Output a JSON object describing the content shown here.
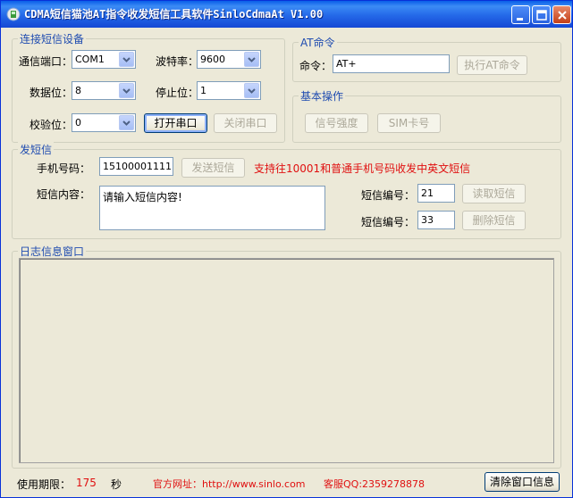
{
  "window": {
    "title": "CDMA短信猫池AT指令收发短信工具软件SinloCdmaAt V1.00"
  },
  "connect_group": {
    "legend": "连接短信设备",
    "port_label": "通信端口：",
    "port_value": "COM1",
    "baud_label": "波特率：",
    "baud_value": "9600",
    "databits_label": "数据位：",
    "databits_value": "8",
    "stopbits_label": "停止位：",
    "stopbits_value": "1",
    "parity_label": "校验位：",
    "parity_value": "0",
    "open_label": "打开串口",
    "close_label": "关闭串口"
  },
  "at_group": {
    "legend": "AT命令",
    "cmd_label": "命令：",
    "cmd_value": "AT+",
    "exec_label": "执行AT命令"
  },
  "basic_group": {
    "legend": "基本操作",
    "signal_label": "信号强度",
    "sim_label": "SIM卡号"
  },
  "sms_group": {
    "legend": "发短信",
    "phone_label": "手机号码：",
    "phone_value": "15100001111",
    "send_label": "发送短信",
    "notice": "支持往10001和普通手机号码收发中英文短信",
    "content_label": "短信内容：",
    "content_value": "请输入短信内容!",
    "read_no_label": "短信编号：",
    "read_no_value": "21",
    "read_label": "读取短信",
    "del_no_label": "短信编号：",
    "del_no_value": "33",
    "delete_label": "删除短信"
  },
  "log_group": {
    "legend": "日志信息窗口"
  },
  "footer": {
    "period_label": "使用期限：",
    "period_value": "175",
    "period_unit": "秒",
    "site_text": "官方网址：http://www.sinlo.com",
    "qq_text": "客服QQ:2359278878",
    "clear_label": "清除窗口信息"
  }
}
